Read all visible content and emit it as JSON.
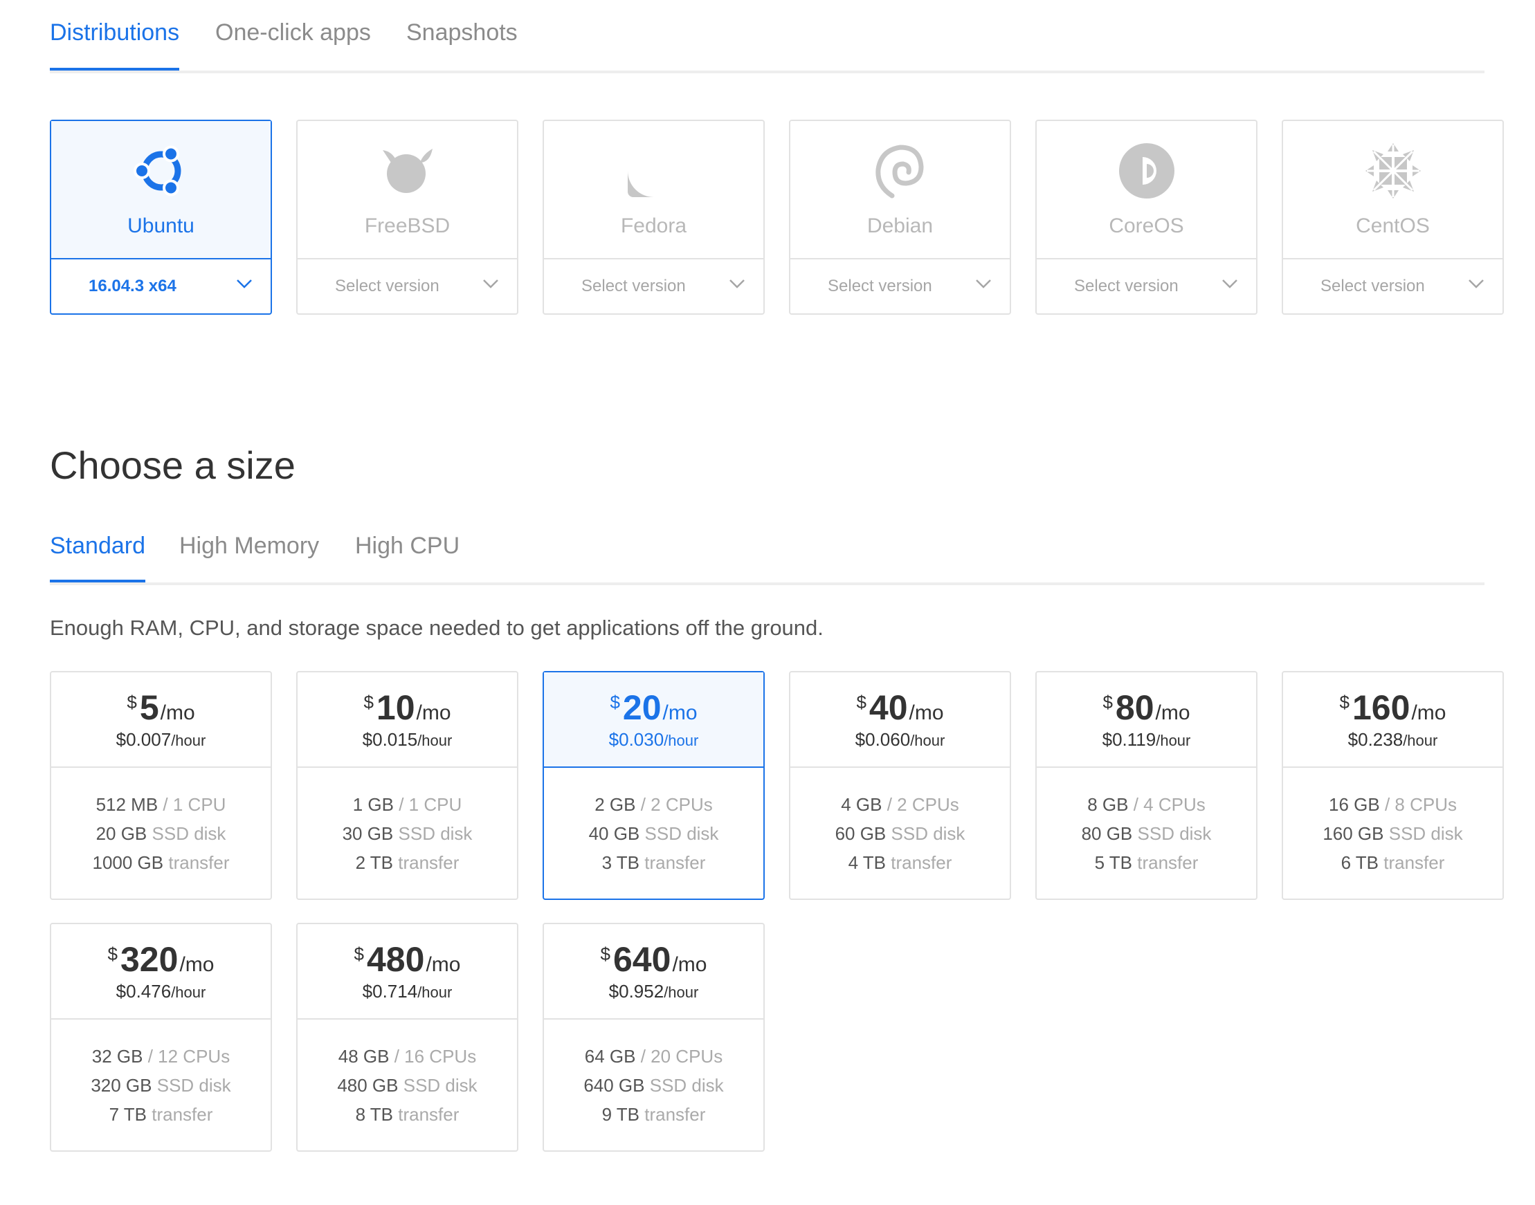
{
  "image_tabs": [
    {
      "label": "Distributions",
      "active": true
    },
    {
      "label": "One-click apps",
      "active": false
    },
    {
      "label": "Snapshots",
      "active": false
    }
  ],
  "distributions": [
    {
      "name": "Ubuntu",
      "version": "16.04.3 x64",
      "icon": "ubuntu-logo-icon",
      "selected": true
    },
    {
      "name": "FreeBSD",
      "version": "Select version",
      "icon": "freebsd-logo-icon",
      "selected": false
    },
    {
      "name": "Fedora",
      "version": "Select version",
      "icon": "fedora-logo-icon",
      "selected": false
    },
    {
      "name": "Debian",
      "version": "Select version",
      "icon": "debian-logo-icon",
      "selected": false
    },
    {
      "name": "CoreOS",
      "version": "Select version",
      "icon": "coreos-logo-icon",
      "selected": false
    },
    {
      "name": "CentOS",
      "version": "Select version",
      "icon": "centos-logo-icon",
      "selected": false
    }
  ],
  "size_section": {
    "title": "Choose a size",
    "tabs": [
      {
        "label": "Standard",
        "active": true
      },
      {
        "label": "High Memory",
        "active": false
      },
      {
        "label": "High CPU",
        "active": false
      }
    ],
    "description": "Enough RAM, CPU, and storage space needed to get applications off the ground.",
    "plans": [
      {
        "currency": "$",
        "amount": "5",
        "per": "/mo",
        "hourly": "$0.007",
        "hour_unit": "/hour",
        "memory": "512 MB",
        "cpu": "/ 1 CPU",
        "disk": "20 GB",
        "disk_unit": "SSD disk",
        "transfer": "1000 GB",
        "transfer_unit": "transfer",
        "selected": false
      },
      {
        "currency": "$",
        "amount": "10",
        "per": "/mo",
        "hourly": "$0.015",
        "hour_unit": "/hour",
        "memory": "1 GB",
        "cpu": "/ 1 CPU",
        "disk": "30 GB",
        "disk_unit": "SSD disk",
        "transfer": "2 TB",
        "transfer_unit": "transfer",
        "selected": false
      },
      {
        "currency": "$",
        "amount": "20",
        "per": "/mo",
        "hourly": "$0.030",
        "hour_unit": "/hour",
        "memory": "2 GB",
        "cpu": "/ 2 CPUs",
        "disk": "40 GB",
        "disk_unit": "SSD disk",
        "transfer": "3 TB",
        "transfer_unit": "transfer",
        "selected": true
      },
      {
        "currency": "$",
        "amount": "40",
        "per": "/mo",
        "hourly": "$0.060",
        "hour_unit": "/hour",
        "memory": "4 GB",
        "cpu": "/ 2 CPUs",
        "disk": "60 GB",
        "disk_unit": "SSD disk",
        "transfer": "4 TB",
        "transfer_unit": "transfer",
        "selected": false
      },
      {
        "currency": "$",
        "amount": "80",
        "per": "/mo",
        "hourly": "$0.119",
        "hour_unit": "/hour",
        "memory": "8 GB",
        "cpu": "/ 4 CPUs",
        "disk": "80 GB",
        "disk_unit": "SSD disk",
        "transfer": "5 TB",
        "transfer_unit": "transfer",
        "selected": false
      },
      {
        "currency": "$",
        "amount": "160",
        "per": "/mo",
        "hourly": "$0.238",
        "hour_unit": "/hour",
        "memory": "16 GB",
        "cpu": "/ 8 CPUs",
        "disk": "160 GB",
        "disk_unit": "SSD disk",
        "transfer": "6 TB",
        "transfer_unit": "transfer",
        "selected": false
      },
      {
        "currency": "$",
        "amount": "320",
        "per": "/mo",
        "hourly": "$0.476",
        "hour_unit": "/hour",
        "memory": "32 GB",
        "cpu": "/ 12 CPUs",
        "disk": "320 GB",
        "disk_unit": "SSD disk",
        "transfer": "7 TB",
        "transfer_unit": "transfer",
        "selected": false
      },
      {
        "currency": "$",
        "amount": "480",
        "per": "/mo",
        "hourly": "$0.714",
        "hour_unit": "/hour",
        "memory": "48 GB",
        "cpu": "/ 16 CPUs",
        "disk": "480 GB",
        "disk_unit": "SSD disk",
        "transfer": "8 TB",
        "transfer_unit": "transfer",
        "selected": false
      },
      {
        "currency": "$",
        "amount": "640",
        "per": "/mo",
        "hourly": "$0.952",
        "hour_unit": "/hour",
        "memory": "64 GB",
        "cpu": "/ 20 CPUs",
        "disk": "640 GB",
        "disk_unit": "SSD disk",
        "transfer": "9 TB",
        "transfer_unit": "transfer",
        "selected": false
      }
    ]
  },
  "colors": {
    "accent": "#1b73e8",
    "selected_bg": "#f3f8fe",
    "border": "#e2e2e2",
    "muted": "#aaaaaa",
    "logo_gray": "#c7c7c7"
  }
}
